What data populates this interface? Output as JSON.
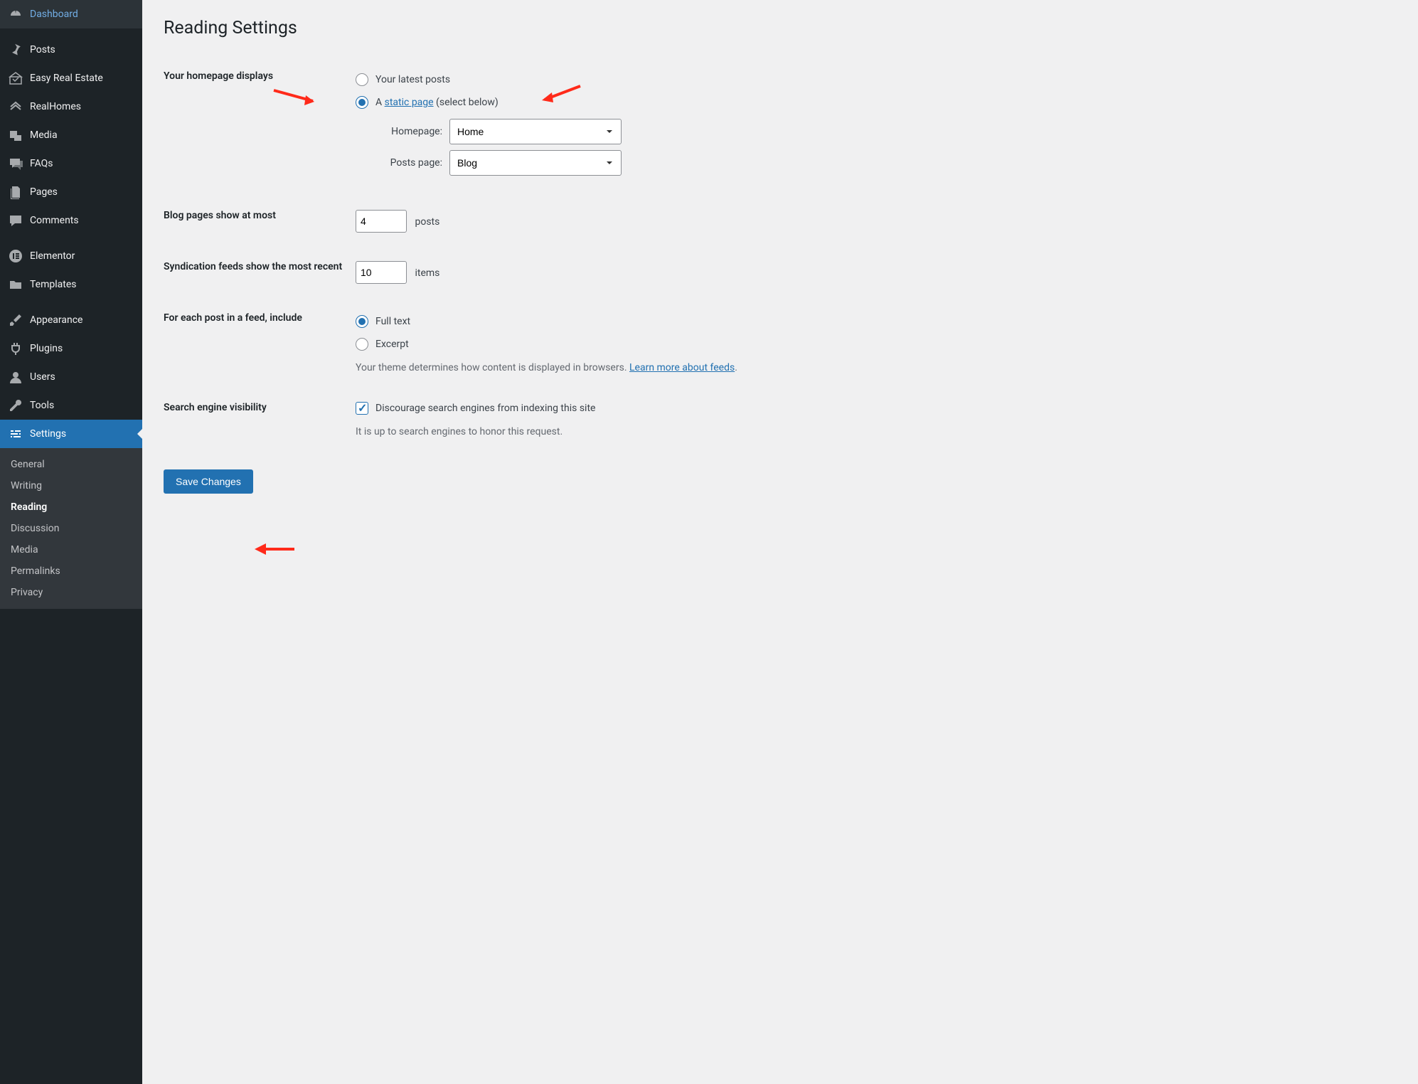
{
  "sidebar": {
    "groups": [
      [
        {
          "icon": "dashboard",
          "label": "Dashboard"
        }
      ],
      [
        {
          "icon": "pin",
          "label": "Posts"
        },
        {
          "icon": "estate",
          "label": "Easy Real Estate"
        },
        {
          "icon": "homes",
          "label": "RealHomes"
        },
        {
          "icon": "media",
          "label": "Media"
        },
        {
          "icon": "faq",
          "label": "FAQs"
        },
        {
          "icon": "pages",
          "label": "Pages"
        },
        {
          "icon": "comment",
          "label": "Comments"
        }
      ],
      [
        {
          "icon": "elementor",
          "label": "Elementor"
        },
        {
          "icon": "folder",
          "label": "Templates"
        }
      ],
      [
        {
          "icon": "brush",
          "label": "Appearance"
        },
        {
          "icon": "plug",
          "label": "Plugins"
        },
        {
          "icon": "user",
          "label": "Users"
        },
        {
          "icon": "wrench",
          "label": "Tools"
        },
        {
          "icon": "sliders",
          "label": "Settings",
          "active": true
        }
      ]
    ],
    "submenu": [
      {
        "label": "General"
      },
      {
        "label": "Writing"
      },
      {
        "label": "Reading",
        "current": true
      },
      {
        "label": "Discussion"
      },
      {
        "label": "Media"
      },
      {
        "label": "Permalinks"
      },
      {
        "label": "Privacy"
      }
    ]
  },
  "page": {
    "title": "Reading Settings",
    "homepage_section_label": "Your homepage displays",
    "radio_latest": "Your latest posts",
    "radio_static_prefix": "A ",
    "radio_static_link": "static page",
    "radio_static_suffix": " (select below)",
    "homepage_label": "Homepage:",
    "homepage_value": "Home",
    "postspage_label": "Posts page:",
    "postspage_value": "Blog",
    "blog_pages_label": "Blog pages show at most",
    "blog_pages_value": "4",
    "blog_pages_suffix": "posts",
    "syndication_label": "Syndication feeds show the most recent",
    "syndication_value": "10",
    "syndication_suffix": "items",
    "feed_include_label": "For each post in a feed, include",
    "feed_full": "Full text",
    "feed_excerpt": "Excerpt",
    "feed_description_prefix": "Your theme determines how content is displayed in browsers. ",
    "feed_description_link": "Learn more about feeds",
    "feed_description_suffix": ".",
    "visibility_label": "Search engine visibility",
    "visibility_checkbox": "Discourage search engines from indexing this site",
    "visibility_description": "It is up to search engines to honor this request.",
    "save_button": "Save Changes"
  }
}
